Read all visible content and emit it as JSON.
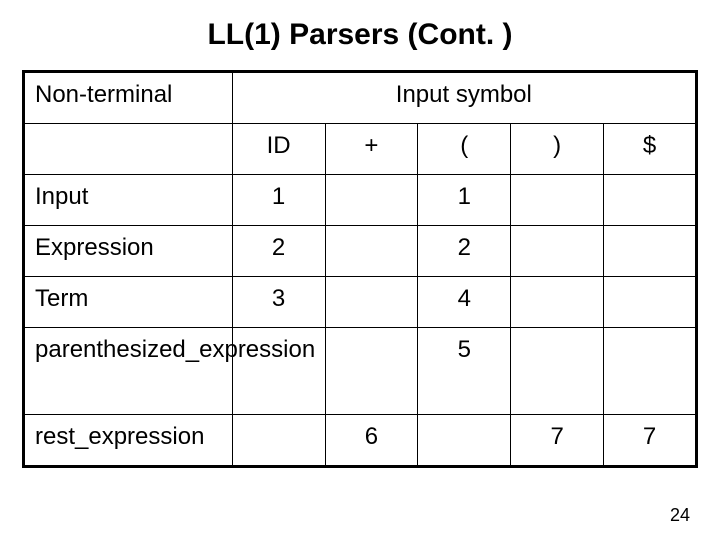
{
  "title": "LL(1) Parsers (Cont. )",
  "page_number": "24",
  "headers": {
    "nonterminal": "Non-terminal",
    "input_symbol": "Input symbol",
    "cols": [
      "ID",
      "+",
      "(",
      ")",
      "$"
    ]
  },
  "rows": [
    {
      "label": "Input",
      "cells": [
        "1",
        "",
        "1",
        "",
        ""
      ]
    },
    {
      "label": "Expression",
      "cells": [
        "2",
        "",
        "2",
        "",
        ""
      ]
    },
    {
      "label": "Term",
      "cells": [
        "3",
        "",
        "4",
        "",
        ""
      ]
    },
    {
      "label": "parenthesized_expression",
      "cells": [
        "",
        "",
        "5",
        "",
        ""
      ]
    },
    {
      "label": "rest_expression",
      "cells": [
        "",
        "6",
        "",
        "7",
        "7"
      ]
    }
  ],
  "chart_data": {
    "type": "table",
    "title": "LL(1) Parsing Table",
    "row_header": "Non-terminal",
    "col_header": "Input symbol",
    "columns": [
      "ID",
      "+",
      "(",
      ")",
      "$"
    ],
    "rows": [
      "Input",
      "Expression",
      "Term",
      "parenthesized_expression",
      "rest_expression"
    ],
    "values": [
      [
        1,
        null,
        1,
        null,
        null
      ],
      [
        2,
        null,
        2,
        null,
        null
      ],
      [
        3,
        null,
        4,
        null,
        null
      ],
      [
        null,
        null,
        5,
        null,
        null
      ],
      [
        null,
        6,
        null,
        7,
        7
      ]
    ]
  }
}
